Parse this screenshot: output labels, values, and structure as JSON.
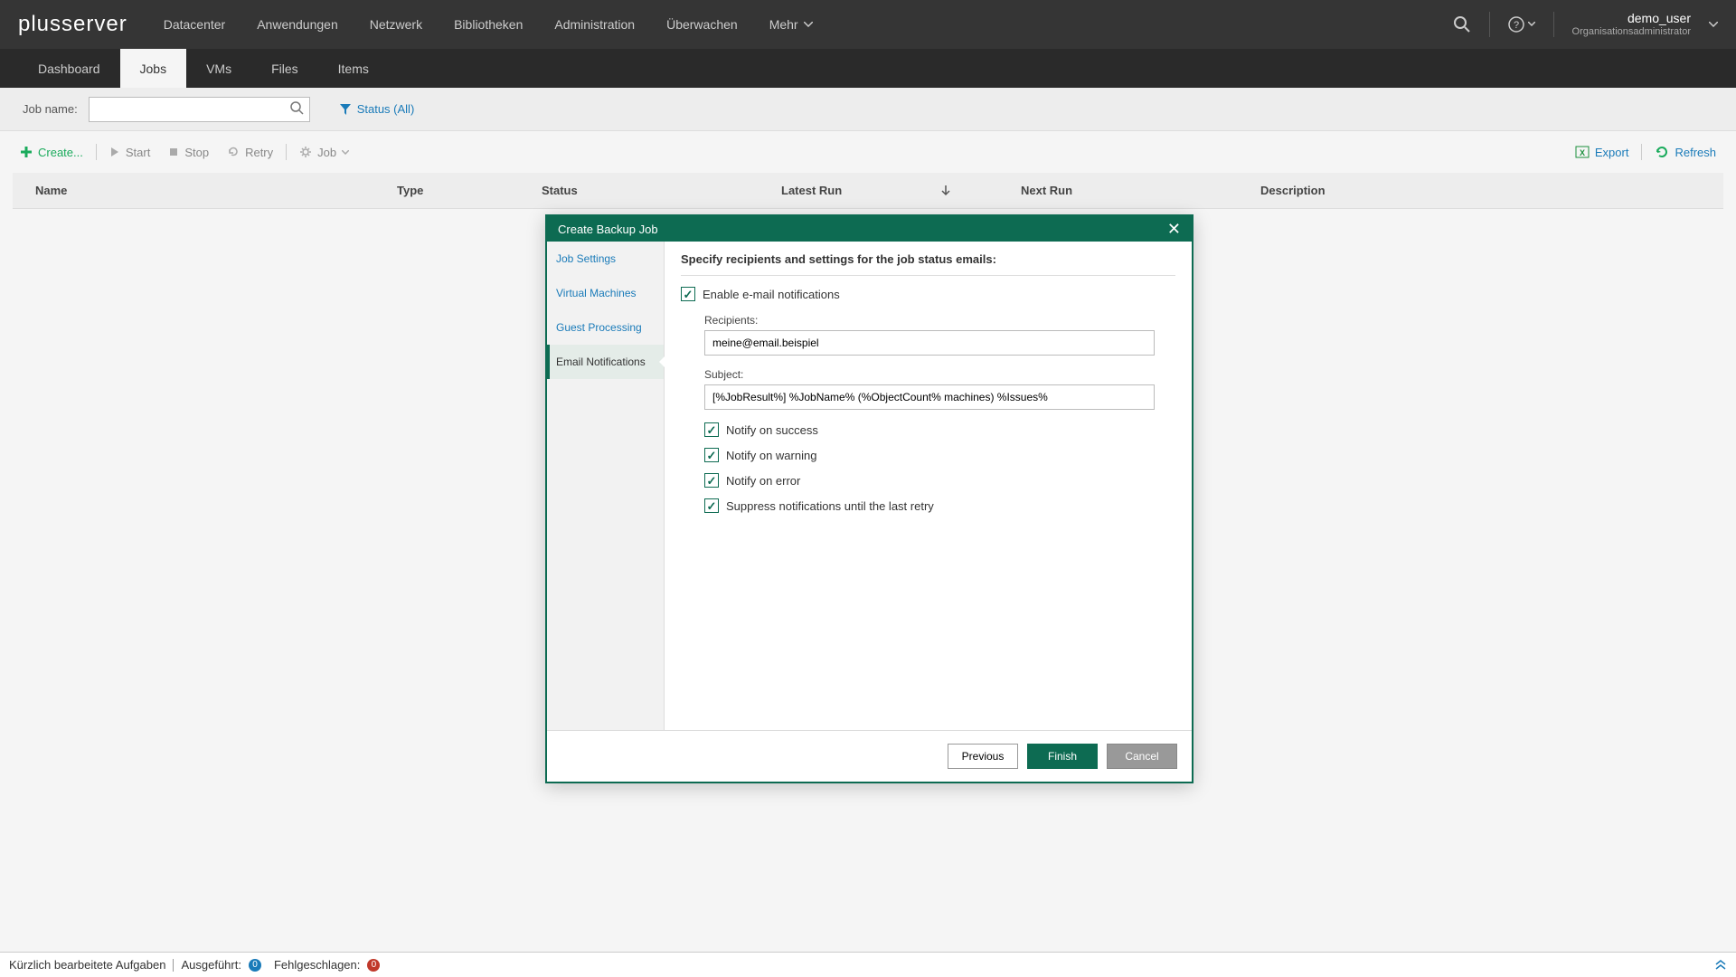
{
  "brand": "plusserver",
  "topnav": [
    "Datacenter",
    "Anwendungen",
    "Netzwerk",
    "Bibliotheken",
    "Administration",
    "Überwachen",
    "Mehr"
  ],
  "user": {
    "name": "demo_user",
    "role": "Organisationsadministrator"
  },
  "subnav": [
    "Dashboard",
    "Jobs",
    "VMs",
    "Files",
    "Items"
  ],
  "subnav_active": 1,
  "filter": {
    "label": "Job name:",
    "status": "Status (All)"
  },
  "toolbar": {
    "create": "Create...",
    "start": "Start",
    "stop": "Stop",
    "retry": "Retry",
    "job": "Job",
    "export": "Export",
    "refresh": "Refresh"
  },
  "columns": {
    "name": "Name",
    "type": "Type",
    "status": "Status",
    "latest": "Latest Run",
    "next": "Next Run",
    "desc": "Description"
  },
  "modal": {
    "title": "Create Backup Job",
    "side": [
      "Job Settings",
      "Virtual Machines",
      "Guest Processing",
      "Email Notifications"
    ],
    "side_active": 3,
    "heading": "Specify recipients and settings for the job status emails:",
    "enable_label": "Enable e-mail notifications",
    "recipients_label": "Recipients:",
    "recipients_value": "meine@email.beispiel",
    "subject_label": "Subject:",
    "subject_value": "[%JobResult%] %JobName% (%ObjectCount% machines) %Issues%",
    "notify_success": "Notify on success",
    "notify_warning": "Notify on warning",
    "notify_error": "Notify on error",
    "suppress": "Suppress notifications until the last retry",
    "previous": "Previous",
    "finish": "Finish",
    "cancel": "Cancel"
  },
  "footer": {
    "recent": "Kürzlich bearbeitete Aufgaben",
    "done_label": "Ausgeführt:",
    "done_count": "0",
    "fail_label": "Fehlgeschlagen:",
    "fail_count": "0"
  }
}
